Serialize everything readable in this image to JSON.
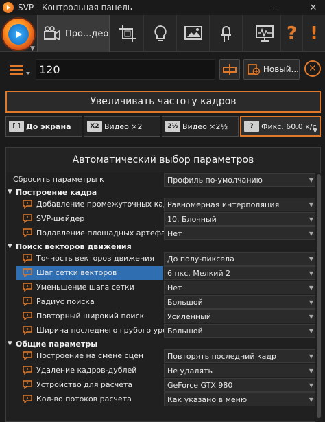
{
  "window": {
    "title": "SVP - Контрольная панель",
    "minimize": "—",
    "close": "✕"
  },
  "toolbar": {
    "active_tab": "Про...део",
    "icons": [
      "film-icon",
      "crop-icon",
      "lightbulb-icon",
      "screen-image-icon",
      "led-icon",
      "monitor-graph-icon",
      "help-icon",
      "exclamation-icon"
    ]
  },
  "profile": {
    "value": "120",
    "new_label": "Новый..."
  },
  "main_button": "Увеличивать частоту кадров",
  "modes": [
    {
      "icon": "[ ]",
      "label": "До экрана"
    },
    {
      "icon": "X2",
      "label": "Видео ×2"
    },
    {
      "icon": "2½",
      "label": "Видео ×2½"
    },
    {
      "icon": "?",
      "label": "Фикс. 60.0 к/с"
    }
  ],
  "panel": {
    "title": "Автоматический выбор параметров"
  },
  "rows": [
    {
      "kind": "row",
      "label": "Сбросить параметры к",
      "value": "Профиль по-умолчанию",
      "icon": false
    },
    {
      "kind": "sec",
      "label": "Построение кадра"
    },
    {
      "kind": "row",
      "label": "Добавление промежуточных кадров",
      "value": "Равномерная интерполяция",
      "icon": true
    },
    {
      "kind": "row",
      "label": "SVP-шейдер",
      "value": "10. Блочный",
      "icon": true
    },
    {
      "kind": "row",
      "label": "Подавление площадных артефактов",
      "value": "Нет",
      "icon": true
    },
    {
      "kind": "sec",
      "label": "Поиск векторов движения"
    },
    {
      "kind": "row",
      "label": "Точность векторов движения",
      "value": "До полу-пиксела",
      "icon": true
    },
    {
      "kind": "row",
      "label": "Шаг сетки векторов",
      "value": "6 пкс. Мелкий 2",
      "icon": true,
      "selected": true
    },
    {
      "kind": "row",
      "label": "Уменьшение шага сетки",
      "value": "Нет",
      "icon": true
    },
    {
      "kind": "row",
      "label": "Радиус поиска",
      "value": "Большой",
      "icon": true
    },
    {
      "kind": "row",
      "label": "Повторный широкий поиск",
      "value": "Усиленный",
      "icon": true
    },
    {
      "kind": "row",
      "label": "Ширина последнего грубого уровня",
      "value": "Большой",
      "icon": true
    },
    {
      "kind": "sec",
      "label": "Общие параметры"
    },
    {
      "kind": "row",
      "label": "Построение на смене сцен",
      "value": "Повторять последний кадр",
      "icon": true
    },
    {
      "kind": "row",
      "label": "Удаление кадров-дублей",
      "value": "Не удалять",
      "icon": true
    },
    {
      "kind": "row",
      "label": "Устройство для расчета",
      "value": "GeForce GTX 980",
      "icon": true
    },
    {
      "kind": "row",
      "label": "Кол-во потоков расчета",
      "value": "Как указано в меню",
      "icon": true
    }
  ],
  "colors": {
    "accent": "#e07a2a",
    "selected": "#2f6eb0",
    "bg": "#1b1b1b"
  }
}
